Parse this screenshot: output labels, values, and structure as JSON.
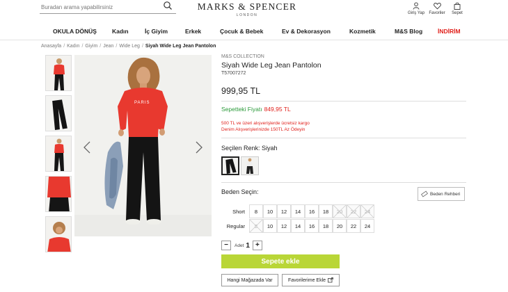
{
  "header": {
    "search_placeholder": "Buradan arama yapabilirsiniz",
    "logo_main": "MARKS & SPENCER",
    "logo_sub": "LONDON",
    "actions": [
      {
        "label": "Giriş Yap",
        "icon": "user-icon"
      },
      {
        "label": "Favoriler",
        "icon": "heart-icon"
      },
      {
        "label": "Sepet",
        "icon": "shopping-bag-icon"
      }
    ]
  },
  "nav": {
    "items": [
      "OKULA DÖNÜŞ",
      "Kadın",
      "İç Giyim",
      "Erkek",
      "Çocuk & Bebek",
      "Ev & Dekorasyon",
      "Kozmetik",
      "M&S Blog",
      "İNDİRİM"
    ],
    "sale_color": "#e0201b"
  },
  "breadcrumb": {
    "items": [
      "Anasayfa",
      "Kadın",
      "Giyim",
      "Jean",
      "Wide Leg"
    ],
    "current": "Siyah Wide Leg Jean Pantolon"
  },
  "product": {
    "collection": "M&S COLLECTION",
    "title": "Siyah Wide Leg Jean Pantolon",
    "sku": "T57007272",
    "price": "999,95 TL",
    "cart_price_label": "Sepetteki Fiyatı",
    "cart_price_value": "849,95 TL",
    "promo_1": "500 TL ve üzeri alışverişlerde ücretsiz kargo",
    "promo_2": "Denim Alışverişlerinizde 150TL Az Ödeyin",
    "selected_color_label": "Seçilen Renk: Siyah",
    "size_label": "Beden Seçin:",
    "size_guide_label": "Beden Rehberi",
    "quantity_label": "Adet",
    "quantity_value": "1",
    "add_to_cart": "Sepete ekle",
    "store_button": "Hangi Mağazada Var",
    "favorite_button": "Favorilerime Ekle",
    "accent_green": "#b9d637",
    "price_green": "#2b9a3a",
    "price_red": "#e0201b"
  },
  "sizes": {
    "short": {
      "label": "Short",
      "values": [
        "8",
        "10",
        "12",
        "14",
        "16",
        "18",
        "20",
        "22",
        "24"
      ],
      "unavailable": [
        "20",
        "22",
        "24"
      ]
    },
    "regular": {
      "label": "Regular",
      "values": [
        "8",
        "10",
        "12",
        "14",
        "16",
        "18",
        "20",
        "22",
        "24"
      ],
      "unavailable": [
        "8"
      ]
    }
  }
}
